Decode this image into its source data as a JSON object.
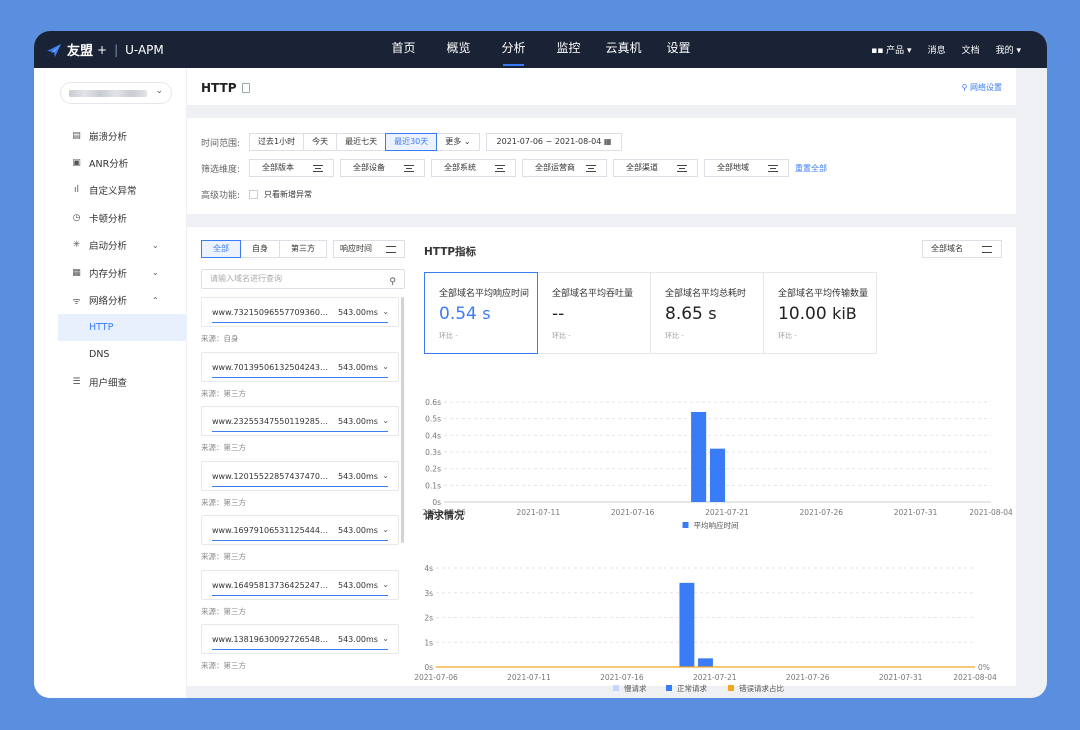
{
  "topbar": {
    "brand": "友盟",
    "plus": "+",
    "sep": "|",
    "product": "U-APM",
    "nav": [
      "首页",
      "概览",
      "分析",
      "监控",
      "云真机",
      "设置"
    ],
    "active_nav": 2,
    "right": [
      "产品",
      "消息",
      "文档",
      "我的"
    ]
  },
  "sidebar": {
    "items": [
      {
        "label": "崩溃分析",
        "icon": "crash-report-icon"
      },
      {
        "label": "ANR分析",
        "icon": "anr-icon"
      },
      {
        "label": "自定义异常",
        "icon": "bar-chart-icon"
      },
      {
        "label": "卡顿分析",
        "icon": "clock-icon"
      },
      {
        "label": "启动分析",
        "icon": "loading-icon"
      },
      {
        "label": "内存分析",
        "icon": "save-icon"
      },
      {
        "label": "网络分析",
        "icon": "wifi-icon"
      },
      {
        "label": "HTTP"
      },
      {
        "label": "DNS"
      },
      {
        "label": "用户细查",
        "icon": "list-icon"
      }
    ]
  },
  "header": {
    "title": "HTTP",
    "network_settings": "网络设置"
  },
  "filters": {
    "time_label": "时间范围:",
    "time_buttons": [
      "过去1小时",
      "今天",
      "最近七天",
      "最近30天",
      "更多"
    ],
    "time_active": 3,
    "date_range": "2021-07-06 ~ 2021-08-04",
    "dim_label": "筛选维度:",
    "dims": [
      "全部版本",
      "全部设备",
      "全部系统",
      "全部运营商",
      "全部渠道",
      "全部地域"
    ],
    "reset": "重置全部",
    "adv_label": "高级功能:",
    "adv_checkbox": "只看新增异常"
  },
  "list": {
    "tabs": [
      "全部",
      "自身",
      "第三方"
    ],
    "active_tab": 0,
    "sort": "响应时间",
    "search_placeholder": "请输入域名进行查询",
    "items": [
      {
        "domain": "www.732150965577093608...",
        "ms": "543.00ms",
        "source": "来源：自身"
      },
      {
        "domain": "www.701395061325042434...",
        "ms": "543.00ms",
        "source": "来源：第三方"
      },
      {
        "domain": "www.232553475501192855...",
        "ms": "543.00ms",
        "source": "来源：第三方"
      },
      {
        "domain": "www.120155228574374702...",
        "ms": "543.00ms",
        "source": "来源：第三方"
      },
      {
        "domain": "www.169791065311254442l...",
        "ms": "543.00ms",
        "source": "来源：第三方"
      },
      {
        "domain": "www.164958137364252479...",
        "ms": "543.00ms",
        "source": "来源：第三方"
      },
      {
        "domain": "www.138196300927265487...",
        "ms": "543.00ms",
        "source": "来源：第三方"
      }
    ]
  },
  "metrics": {
    "title": "HTTP指标",
    "domain_select": "全部域名",
    "cards": [
      {
        "label": "全部域名平均响应时间",
        "value": "0.54",
        "unit": "s",
        "compare": "环比  -"
      },
      {
        "label": "全部域名平均吞吐量",
        "value": "--",
        "unit": "",
        "compare": "环比  -"
      },
      {
        "label": "全部域名平均总耗时",
        "value": "8.65",
        "unit": "s",
        "compare": "环比  -"
      },
      {
        "label": "全部域名平均传输数量",
        "value": "10.00",
        "unit": "kiB",
        "compare": "环比  -"
      }
    ],
    "requests_title": "请求情况"
  },
  "chart_data": [
    {
      "type": "bar",
      "x_ticks": [
        "2021-07-06",
        "2021-07-11",
        "2021-07-16",
        "2021-07-21",
        "2021-07-26",
        "2021-07-31",
        "2021-08-04"
      ],
      "y_ticks": [
        "0s",
        "0.1s",
        "0.2s",
        "0.3s",
        "0.4s",
        "0.5s",
        "0.6s"
      ],
      "ylim": [
        0,
        0.6
      ],
      "series": [
        {
          "name": "平均响应时间",
          "color": "#3a7cf5",
          "points": [
            {
              "x": "2021-07-19",
              "y": 0.54
            },
            {
              "x": "2021-07-20",
              "y": 0.32
            }
          ]
        }
      ],
      "legend": "bottom",
      "grid": true
    },
    {
      "type": "bar",
      "x_ticks": [
        "2021-07-06",
        "2021-07-11",
        "2021-07-16",
        "2021-07-21",
        "2021-07-26",
        "2021-07-31",
        "2021-08-04"
      ],
      "y_ticks": [
        "0s",
        "1s",
        "2s",
        "3s",
        "4s"
      ],
      "y2_ticks": [
        "0%"
      ],
      "ylim": [
        0,
        4
      ],
      "series": [
        {
          "name": "慢请求",
          "color": "#c5d8fb",
          "points": []
        },
        {
          "name": "正常请求",
          "color": "#3a7cf5",
          "points": [
            {
              "x": "2021-07-19",
              "y": 3.4
            },
            {
              "x": "2021-07-20",
              "y": 0.35
            }
          ]
        },
        {
          "name": "错误请求占比",
          "color": "#f5a623",
          "line": true,
          "points": []
        }
      ],
      "legend": "bottom",
      "grid": true
    }
  ]
}
